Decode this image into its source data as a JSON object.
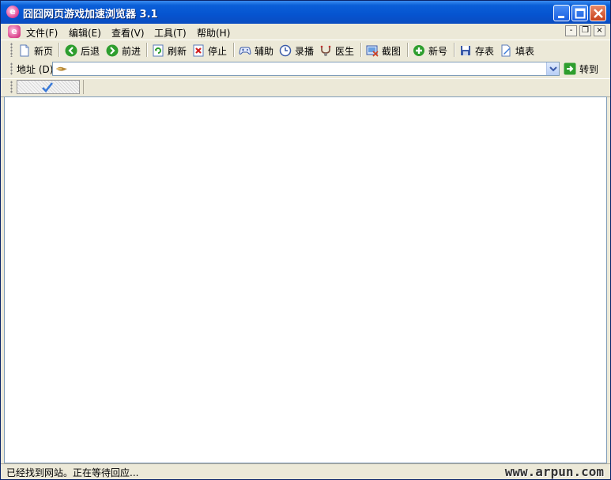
{
  "window": {
    "title": "囧囧网页游戏加速浏览器 3.1"
  },
  "menu": {
    "items": [
      {
        "label": "文件(F)"
      },
      {
        "label": "编辑(E)"
      },
      {
        "label": "查看(V)"
      },
      {
        "label": "工具(T)"
      },
      {
        "label": "帮助(H)"
      }
    ],
    "mdi_minimize": "-",
    "mdi_restore": "❐",
    "mdi_close": "×"
  },
  "toolbar": {
    "new_page": "新页",
    "back": "后退",
    "forward": "前进",
    "refresh": "刷新",
    "stop": "停止",
    "assist": "辅助",
    "record": "录播",
    "doctor": "医生",
    "screenshot": "截图",
    "new_account": "新号",
    "save_table": "存表",
    "fill_table": "填表"
  },
  "address": {
    "label": "地址 (D)",
    "value": "",
    "go_label": "转到"
  },
  "tabs": [
    {
      "label": "",
      "active": true
    }
  ],
  "status": {
    "text": "已经找到网站。正在等待回应...",
    "brand": "www.arpun.com"
  },
  "colors": {
    "title_bar": "#0654d0",
    "chrome": "#ece9d8",
    "content": "#ffffff",
    "border": "#7f9db9"
  }
}
